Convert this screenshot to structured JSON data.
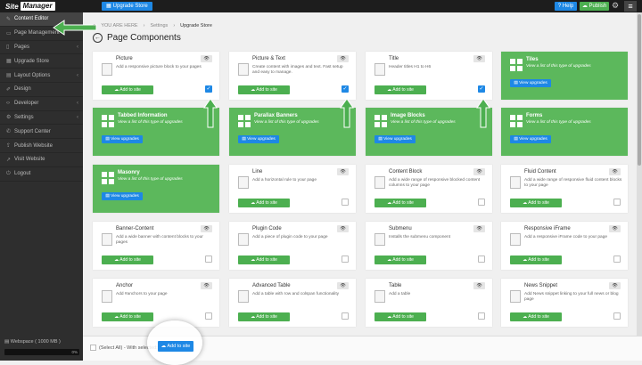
{
  "topbar": {
    "logo_site": "Site",
    "logo_manager": "Manager",
    "upgrade_label": "Upgrade Store",
    "help_label": "Help",
    "publish_label": "Publish"
  },
  "sidebar": {
    "items": [
      {
        "label": "Content Editor",
        "icon": "pencil-icon",
        "chev": ""
      },
      {
        "label": "Page Management",
        "icon": "folder-icon",
        "chev": ""
      },
      {
        "label": "Pages",
        "icon": "pages-icon",
        "chev": "‹"
      },
      {
        "label": "Upgrade Store",
        "icon": "store-icon",
        "chev": ""
      },
      {
        "label": "Layout Options",
        "icon": "layout-icon",
        "chev": "‹"
      },
      {
        "label": "Design",
        "icon": "brush-icon",
        "chev": ""
      },
      {
        "label": "Developer",
        "icon": "code-icon",
        "chev": "‹"
      },
      {
        "label": "Settings",
        "icon": "gear-icon",
        "chev": "‹"
      },
      {
        "label": "Support Center",
        "icon": "support-icon",
        "chev": ""
      },
      {
        "label": "Publish Website",
        "icon": "upload-icon",
        "chev": ""
      },
      {
        "label": "Visit Website",
        "icon": "external-link-icon",
        "chev": ""
      },
      {
        "label": "Logout",
        "icon": "power-icon",
        "chev": ""
      }
    ],
    "webspace_label": "Webspace ( 1000 MB )",
    "webspace_pct": "0%",
    "webspace_fraction": 0
  },
  "breadcrumb": {
    "home": "YOU ARE HERE",
    "crumb1": "Settings",
    "crumb2": "Upgrade Store"
  },
  "page_title": "Page Components",
  "add_label": "Add to site",
  "view_label": "View upgrades",
  "green_desc": "View a list of this type of upgrades",
  "cards": [
    {
      "type": "white",
      "name": "Picture",
      "desc": "Add a responsive picture block to your pages",
      "checked": true
    },
    {
      "type": "white",
      "name": "Picture & Text",
      "desc": "Create content with images and text. Fast setup and easy to manage.",
      "checked": true
    },
    {
      "type": "white",
      "name": "Title",
      "desc": "Header titles H1 to H6",
      "checked": true
    },
    {
      "type": "green",
      "name": "Tiles"
    },
    {
      "type": "green",
      "name": "Tabbed Information"
    },
    {
      "type": "green",
      "name": "Parallax Banners"
    },
    {
      "type": "green",
      "name": "Image Blocks"
    },
    {
      "type": "green",
      "name": "Forms"
    },
    {
      "type": "green",
      "name": "Masonry"
    },
    {
      "type": "white",
      "name": "Line",
      "desc": "Add a horizontal rule to your page",
      "checked": false
    },
    {
      "type": "white",
      "name": "Content Block",
      "desc": "Add a wide range of responsive blocked content columns to your page",
      "checked": false
    },
    {
      "type": "white",
      "name": "Fluid Content",
      "desc": "Add a wide range of responsive fluid content blocks to your page",
      "checked": false
    },
    {
      "type": "white",
      "name": "Banner-Content",
      "desc": "Add a wide banner with content blocks to your pages",
      "checked": false
    },
    {
      "type": "white",
      "name": "Plugin Code",
      "desc": "Add a piece of plugin code to your page",
      "checked": false
    },
    {
      "type": "white",
      "name": "Submenu",
      "desc": "Installs the submenu component",
      "checked": false
    },
    {
      "type": "white",
      "name": "Responsive iFrame",
      "desc": "Add a responsive iFrame code to your page",
      "checked": false
    },
    {
      "type": "white",
      "name": "Anchor",
      "desc": "Add #anchors to your page",
      "checked": false
    },
    {
      "type": "white",
      "name": "Advanced Table",
      "desc": "Add a table with row and colspan functionality",
      "checked": false
    },
    {
      "type": "white",
      "name": "Table",
      "desc": "Add a table",
      "checked": false
    },
    {
      "type": "white",
      "name": "News Snippet",
      "desc": "Add News snippet linking to your full news or blog page",
      "checked": false
    }
  ],
  "bottom": {
    "select_all": "(Select All) - With selected:",
    "add_label": "Add to site"
  },
  "colors": {
    "green": "#5cb85c",
    "blue": "#1e88e5",
    "sidebar": "#2e2e2e"
  }
}
